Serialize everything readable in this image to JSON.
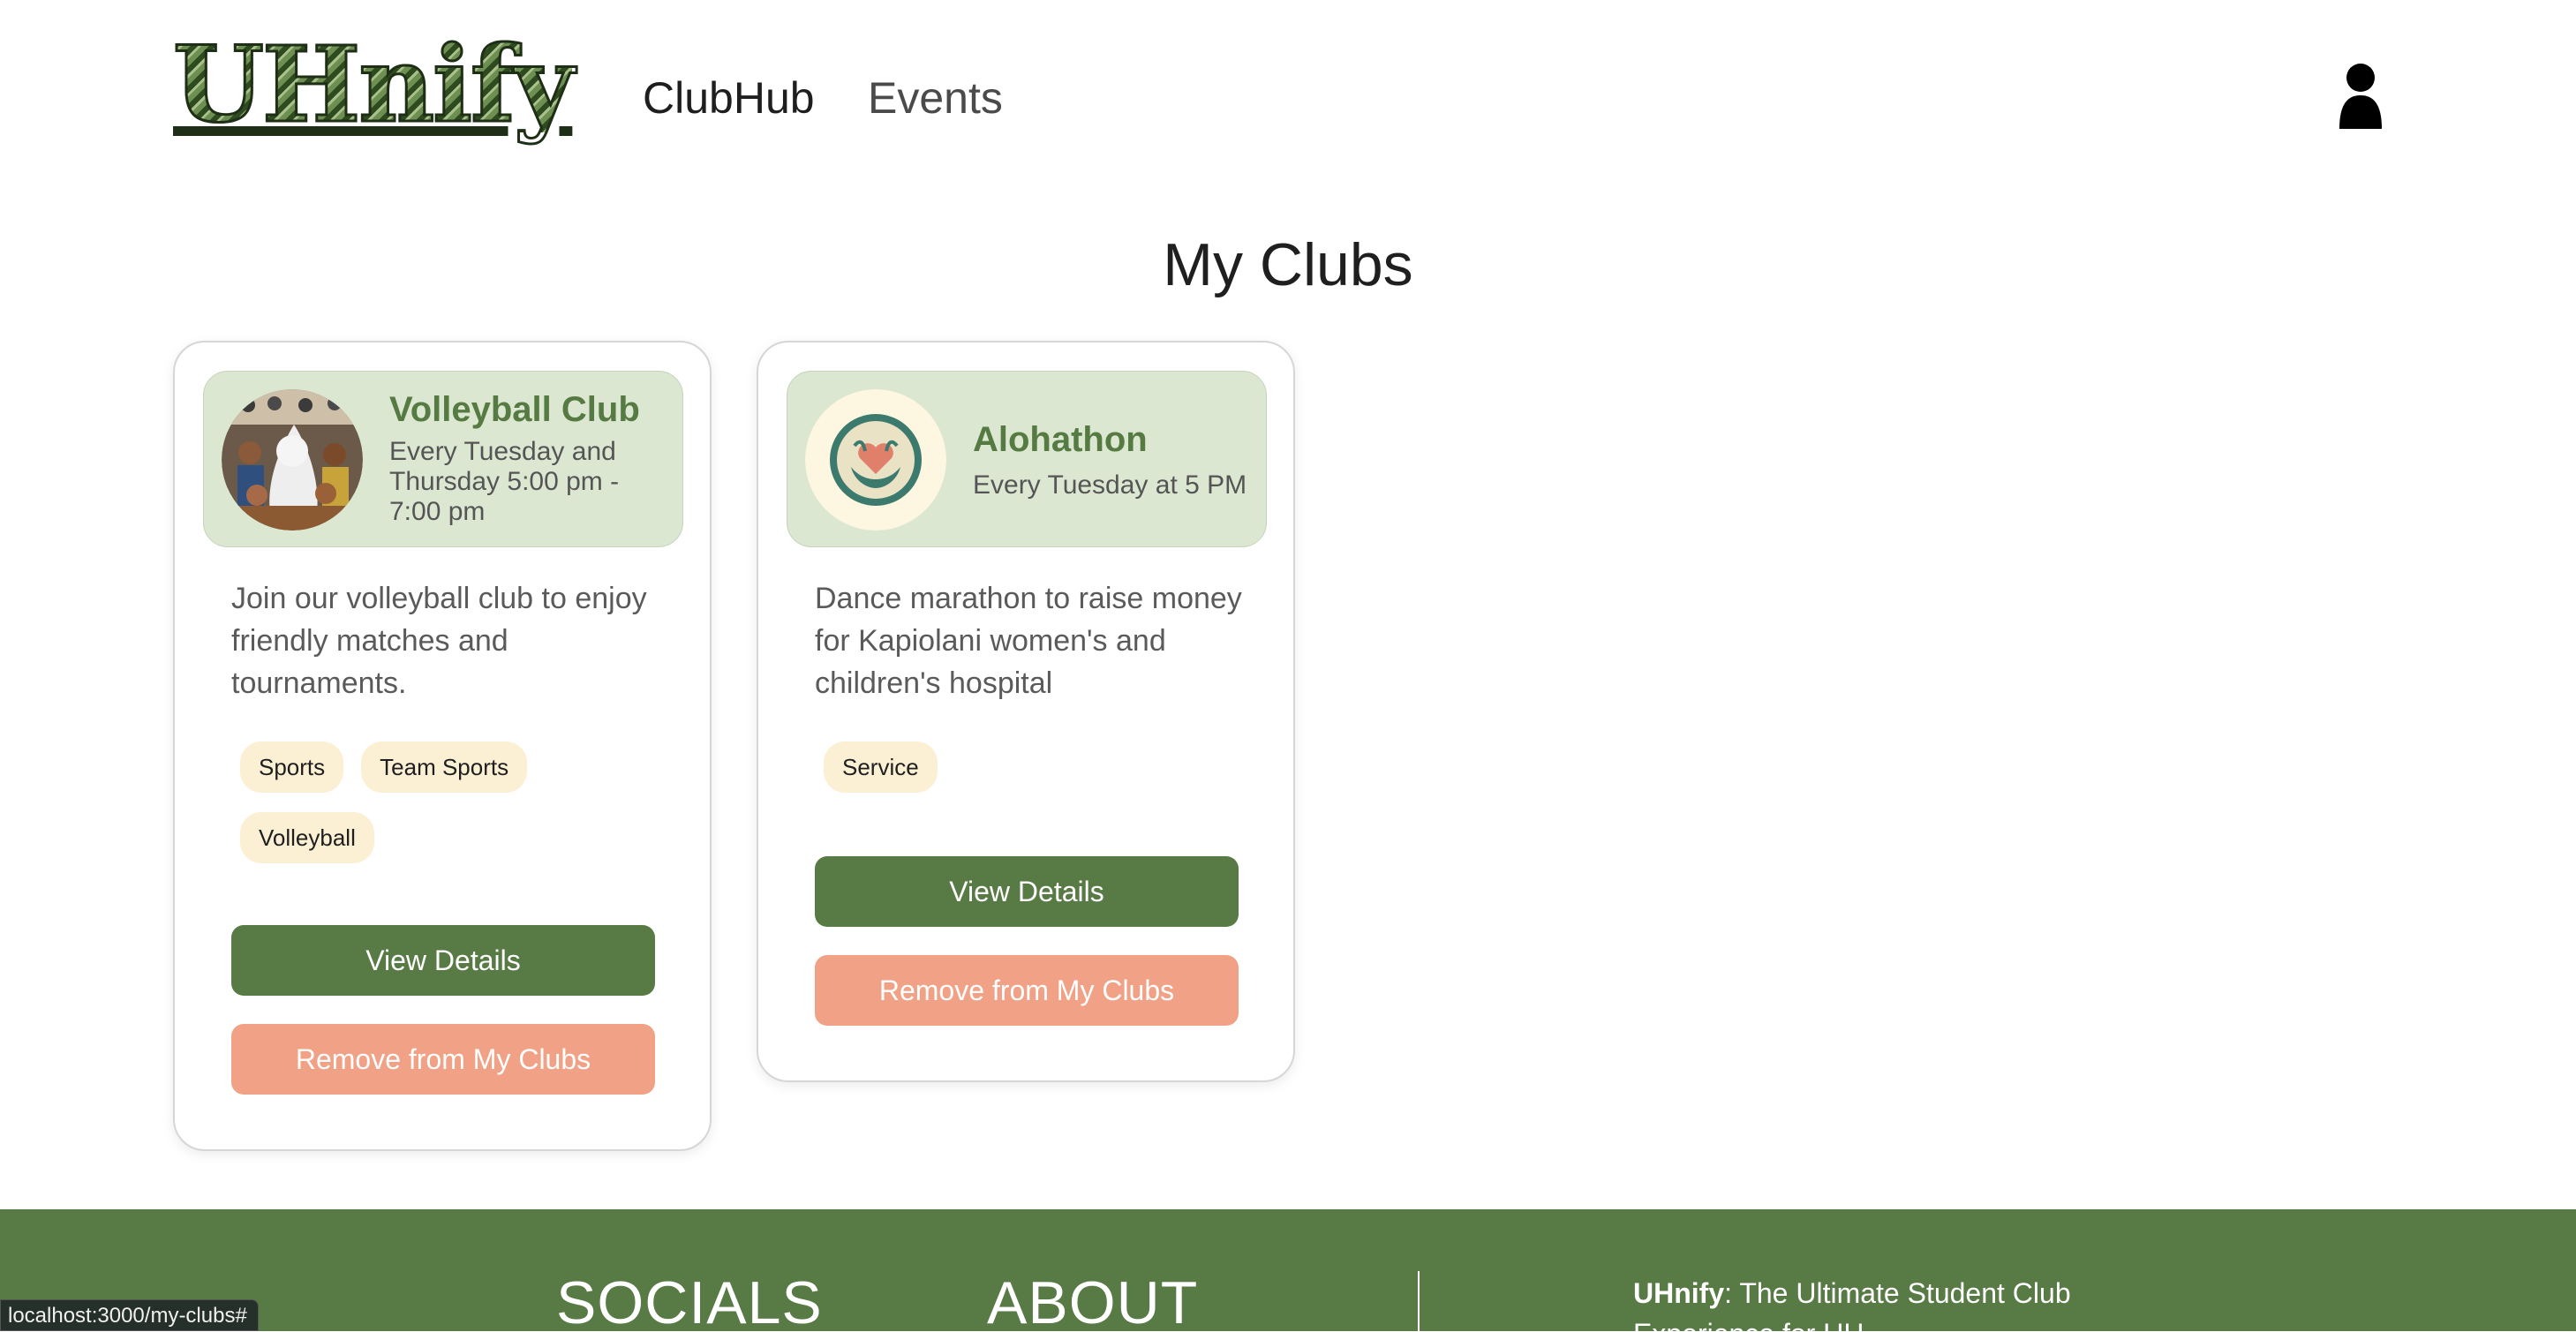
{
  "navbar": {
    "logo_text": "UHnify",
    "links": [
      {
        "label": "ClubHub"
      },
      {
        "label": "Events"
      }
    ],
    "user_icon": "user-icon"
  },
  "page": {
    "title": "My Clubs"
  },
  "clubs": [
    {
      "name": "Volleyball Club",
      "schedule": "Every Tuesday and Thursday 5:00 pm - 7:00 pm",
      "description": "Join our volleyball club to enjoy friendly matches and tournaments.",
      "tags": [
        "Sports",
        "Team Sports",
        "Volleyball"
      ],
      "view_label": "View Details",
      "remove_label": "Remove from My Clubs"
    },
    {
      "name": "Alohathon",
      "schedule": "Every Tuesday at 5 PM",
      "description": "Dance marathon to raise money for Kapiolani women's and children's hospital",
      "tags": [
        "Service"
      ],
      "view_label": "View Details",
      "remove_label": "Remove from My Clubs"
    }
  ],
  "footer": {
    "socials_heading": "SOCIALS",
    "about_heading": "ABOUT",
    "brand": "UHnify",
    "tagline": ": The Ultimate Student Club Experience for UH"
  },
  "status_bar": {
    "url": "localhost:3000/my-clubs#"
  },
  "colors": {
    "primary_green": "#587a45",
    "header_green": "#dce7d2",
    "club_name_green": "#557a42",
    "remove_salmon": "#f0a186",
    "tag_cream": "#fbefd4"
  }
}
